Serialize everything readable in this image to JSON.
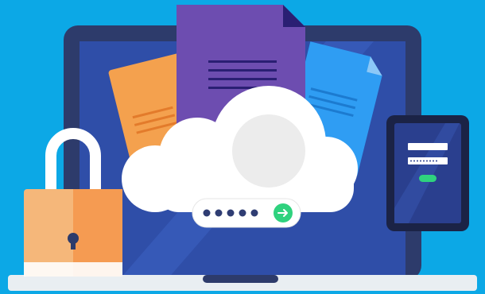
{
  "scene": {
    "colors": {
      "background": "#0ca8e6",
      "laptop_frame": "#2d3b6b",
      "laptop_screen": "#2f4ea8",
      "laptop_base": "#e9eef2",
      "doc_orange": "#f4a14e",
      "doc_purple": "#6d4db0",
      "doc_blue": "#2f9df3",
      "cloud": "#ffffff",
      "avatar": "#ececec",
      "password_dots": "#2f3d73",
      "go_button": "#2fd27e",
      "padlock_body": "#f5b77a",
      "padlock_shackle": "#ffffff",
      "tablet_frame": "#1b2346",
      "tablet_screen": "#2a3f8e",
      "tablet_button": "#2fd27e"
    },
    "icons": [
      "laptop-icon",
      "document-icon",
      "cloud-icon",
      "padlock-icon",
      "tablet-icon",
      "arrow-right-icon"
    ],
    "password_dot_count": 5
  }
}
